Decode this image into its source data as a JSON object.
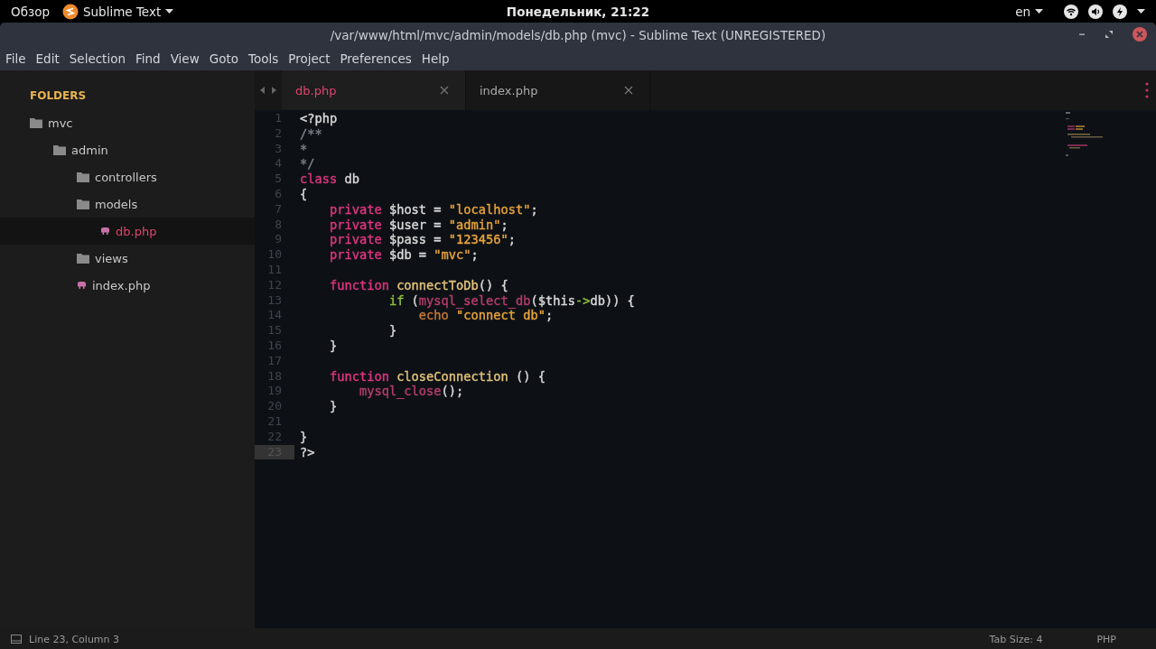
{
  "top_bar": {
    "activities": "Обзор",
    "app_menu": "Sublime Text",
    "clock": "Понедельник, 21:22",
    "language": "en"
  },
  "window": {
    "title": "/var/www/html/mvc/admin/models/db.php (mvc) - Sublime Text (UNREGISTERED)"
  },
  "menu": [
    "File",
    "Edit",
    "Selection",
    "Find",
    "View",
    "Goto",
    "Tools",
    "Project",
    "Preferences",
    "Help"
  ],
  "sidebar": {
    "heading": "FOLDERS",
    "items": [
      {
        "label": "mvc",
        "kind": "folder",
        "selected": false,
        "children": [
          {
            "label": "admin",
            "kind": "folder",
            "selected": false,
            "children": [
              {
                "label": "controllers",
                "kind": "folder",
                "selected": false
              },
              {
                "label": "models",
                "kind": "folder",
                "selected": false,
                "children": [
                  {
                    "label": "db.php",
                    "kind": "file",
                    "selected": true
                  }
                ]
              },
              {
                "label": "views",
                "kind": "folder",
                "selected": false
              },
              {
                "label": "index.php",
                "kind": "file",
                "selected": false
              }
            ]
          }
        ]
      }
    ]
  },
  "tabs": [
    {
      "label": "db.php",
      "selected": true
    },
    {
      "label": "index.php",
      "selected": false
    }
  ],
  "editor": {
    "lines": [
      {
        "number": "1",
        "current": false,
        "tokens": [
          {
            "t": "<?php",
            "color": "#d8d8d8"
          }
        ]
      },
      {
        "number": "2",
        "current": false,
        "tokens": [
          {
            "t": "/**",
            "color": "#7a7f86"
          }
        ]
      },
      {
        "number": "3",
        "current": false,
        "tokens": [
          {
            "t": "*",
            "color": "#7a7f86"
          }
        ]
      },
      {
        "number": "4",
        "current": false,
        "tokens": [
          {
            "t": "*/",
            "color": "#7a7f86"
          }
        ]
      },
      {
        "number": "5",
        "current": false,
        "tokens": [
          {
            "t": "class",
            "color": "#e0357f"
          },
          {
            "t": " db",
            "color": "#d8d8d8"
          }
        ]
      },
      {
        "number": "6",
        "current": false,
        "tokens": [
          {
            "t": "{",
            "color": "#d8d8d8"
          }
        ]
      },
      {
        "number": "7",
        "current": false,
        "tokens": [
          {
            "t": "    private",
            "color": "#e0357f"
          },
          {
            "t": " $host = ",
            "color": "#d8d8d8"
          },
          {
            "t": "\"localhost\"",
            "color": "#e8a33a"
          },
          {
            "t": ";",
            "color": "#d8d8d8"
          }
        ]
      },
      {
        "number": "8",
        "current": false,
        "tokens": [
          {
            "t": "    private",
            "color": "#e0357f"
          },
          {
            "t": " $user = ",
            "color": "#d8d8d8"
          },
          {
            "t": "\"admin\"",
            "color": "#e8a33a"
          },
          {
            "t": ";",
            "color": "#d8d8d8"
          }
        ]
      },
      {
        "number": "9",
        "current": false,
        "tokens": [
          {
            "t": "    private",
            "color": "#e0357f"
          },
          {
            "t": " $pass = ",
            "color": "#d8d8d8"
          },
          {
            "t": "\"123456\"",
            "color": "#e8a33a"
          },
          {
            "t": ";",
            "color": "#d8d8d8"
          }
        ]
      },
      {
        "number": "10",
        "current": false,
        "tokens": [
          {
            "t": "    private",
            "color": "#e0357f"
          },
          {
            "t": " $db = ",
            "color": "#d8d8d8"
          },
          {
            "t": "\"mvc\"",
            "color": "#e8a33a"
          },
          {
            "t": ";",
            "color": "#d8d8d8"
          }
        ]
      },
      {
        "number": "11",
        "current": false
      },
      {
        "number": "12",
        "current": false,
        "tokens": [
          {
            "t": "    function",
            "color": "#e0357f"
          },
          {
            "t": " connectToDb",
            "color": "#e3c27a"
          },
          {
            "t": "() {",
            "color": "#d8d8d8"
          }
        ]
      },
      {
        "number": "13",
        "current": false,
        "tokens": [
          {
            "t": "            if",
            "color": "#8fbf3c"
          },
          {
            "t": " (",
            "color": "#d8d8d8"
          },
          {
            "t": "mysql_select_db",
            "color": "#b63c6b"
          },
          {
            "t": "($this",
            "color": "#d8d8d8"
          },
          {
            "t": "->",
            "color": "#8fbf3c"
          },
          {
            "t": "db)) {",
            "color": "#d8d8d8"
          }
        ]
      },
      {
        "number": "14",
        "current": false,
        "tokens": [
          {
            "t": "                echo",
            "color": "#c4773a"
          },
          {
            "t": " \"connect db\"",
            "color": "#e8a33a"
          },
          {
            "t": ";",
            "color": "#d8d8d8"
          }
        ]
      },
      {
        "number": "15",
        "current": false,
        "tokens": [
          {
            "t": "            }",
            "color": "#d8d8d8"
          }
        ]
      },
      {
        "number": "16",
        "current": false,
        "tokens": [
          {
            "t": "    }",
            "color": "#d8d8d8"
          }
        ]
      },
      {
        "number": "17",
        "current": false
      },
      {
        "number": "18",
        "current": false,
        "tokens": [
          {
            "t": "    function",
            "color": "#e0357f"
          },
          {
            "t": " closeConnection",
            "color": "#e3c27a"
          },
          {
            "t": " () {",
            "color": "#d8d8d8"
          }
        ]
      },
      {
        "number": "19",
        "current": false,
        "tokens": [
          {
            "t": "        mysql_close",
            "color": "#b63c6b"
          },
          {
            "t": "();",
            "color": "#d8d8d8"
          }
        ]
      },
      {
        "number": "20",
        "current": false,
        "tokens": [
          {
            "t": "    }",
            "color": "#d8d8d8"
          }
        ]
      },
      {
        "number": "21",
        "current": false
      },
      {
        "number": "22",
        "current": false,
        "tokens": [
          {
            "t": "}",
            "color": "#d8d8d8"
          }
        ]
      },
      {
        "number": "23",
        "current": true,
        "tokens": [
          {
            "t": "?>",
            "color": "#d8d8d8"
          }
        ]
      }
    ]
  },
  "status_bar": {
    "position": "Line 23, Column 3",
    "tab_size": "Tab Size: 4",
    "syntax": "PHP"
  }
}
